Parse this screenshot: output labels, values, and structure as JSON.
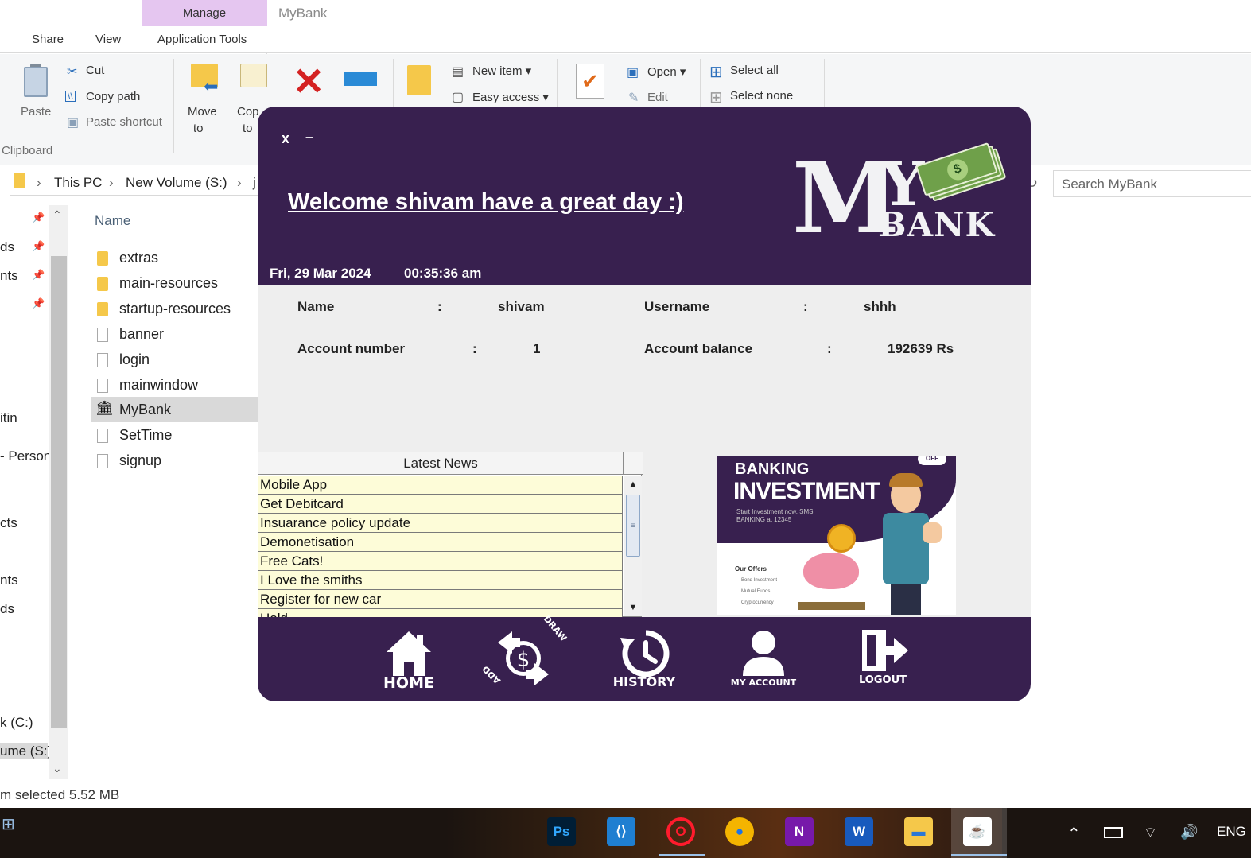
{
  "explorer": {
    "manage_tab": "Manage",
    "window_title": "MyBank",
    "tabs": {
      "share": "Share",
      "view": "View",
      "app_tools": "Application Tools"
    },
    "ribbon": {
      "paste": "Paste",
      "cut": "Cut",
      "copy_path": "Copy path",
      "paste_shortcut": "Paste shortcut",
      "clipboard_group": "Clipboard",
      "move_to_1": "Move",
      "move_to_2": "to",
      "copy_to_1": "Cop",
      "copy_to_2": "to",
      "new_item": "New item",
      "easy_access": "Easy access",
      "open": "Open",
      "edit": "Edit",
      "select_all": "Select all",
      "select_none": "Select none"
    },
    "address": {
      "this_pc": "This PC",
      "volume": "New Volume (S:)",
      "tail": "j"
    },
    "search_placeholder": "Search MyBank",
    "nav_pane": [
      "ds",
      "nts",
      "itin",
      "- Person",
      "cts",
      "nts",
      "ds",
      "k (C:)",
      "ume (S:)"
    ],
    "column_name": "Name",
    "files": [
      "extras",
      "main-resources",
      "startup-resources",
      "banner",
      "login",
      "mainwindow",
      "MyBank",
      "SetTime",
      "signup"
    ],
    "status": "m selected  5.52 MB"
  },
  "taskbar": {
    "apps": [
      {
        "name": "photoshop-icon",
        "glyph": "Ps",
        "color": "#31a8ff",
        "bg": "#001e36"
      },
      {
        "name": "vscode-icon",
        "glyph": "⟨⟩",
        "color": "#ffffff",
        "bg": "#1f7fd1"
      },
      {
        "name": "opera-icon",
        "glyph": "O",
        "color": "#ff1b2d",
        "bg": "transparent"
      },
      {
        "name": "chrome-icon",
        "glyph": "●",
        "color": "#1a73e8",
        "bg": "#f4b400"
      },
      {
        "name": "onenote-icon",
        "glyph": "N",
        "color": "#ffffff",
        "bg": "#7719aa"
      },
      {
        "name": "word-icon",
        "glyph": "W",
        "color": "#ffffff",
        "bg": "#185abd"
      },
      {
        "name": "file-explorer-icon",
        "glyph": "▬",
        "color": "#2a78d6",
        "bg": "#f5c84a"
      },
      {
        "name": "java-icon",
        "glyph": "☕",
        "color": "#e76f00",
        "bg": "#ffffff"
      }
    ],
    "language": "ENG"
  },
  "mybank": {
    "close": "x",
    "minimize": "–",
    "welcome": "Welcome shivam have a great day :)",
    "date": "Fri, 29 Mar 2024",
    "time": "00:35:36 am",
    "logo": {
      "m": "M",
      "y": "Y",
      "bank": "BANK"
    },
    "info": {
      "name_label": "Name",
      "name_value": "shivam",
      "username_label": "Username",
      "username_value": "shhh",
      "account_number_label": "Account number",
      "account_number_value": "1",
      "balance_label": "Account balance",
      "balance_value": "192639 Rs",
      "colon": ":"
    },
    "news": {
      "header": "Latest News",
      "items": [
        "Mobile App",
        "Get Debitcard",
        "Insuarance policy update",
        "Demonetisation",
        "Free Cats!",
        "I Love the smiths",
        "Register for new car",
        "Hold..."
      ]
    },
    "ad": {
      "banking": "BANKING",
      "investment": "INVESTMENT",
      "start": "Start Investment now. SMS BANKING at 12345",
      "offers": "Our Offers",
      "offer_items": [
        "Bond Investment",
        "Mutual Funds",
        "Cryptocurrency"
      ],
      "badge": "OFF"
    },
    "nav": {
      "home": "HOME",
      "transfer_draw": "DRAW",
      "transfer_add": "ADD",
      "history": "HISTORY",
      "my_account": "MY ACCOUNT",
      "logout": "LOGOUT"
    }
  }
}
